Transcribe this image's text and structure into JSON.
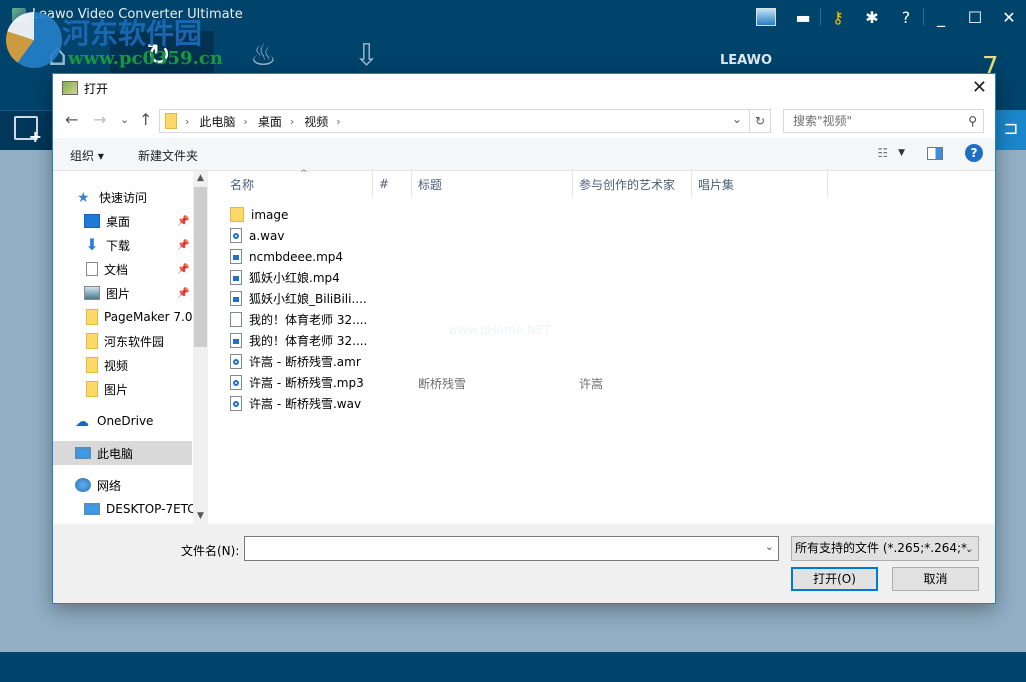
{
  "app": {
    "title": "Leawo Video Converter Ultimate",
    "brand": "LEAWO",
    "version_mark": "7",
    "watermark": {
      "line1": "河东软件园",
      "line2": "www.pc0359.cn"
    },
    "top_icons": [
      "store-icon",
      "chat-icon",
      "key-icon",
      "gear-icon",
      "help-icon",
      "minimize-icon",
      "maximize-icon",
      "close-icon"
    ],
    "accent": "#00436b"
  },
  "dialog": {
    "title": "打开",
    "close": "✕",
    "nav": {
      "back": "←",
      "forward": "→",
      "recent": "⌄",
      "up": "↑"
    },
    "breadcrumb": [
      "此电脑",
      "桌面",
      "视频"
    ],
    "search_placeholder": "搜索\"视频\"",
    "toolbar": {
      "organize": "组织 ▾",
      "new_folder": "新建文件夹"
    },
    "tree": {
      "items": [
        {
          "label": "快速访问",
          "icon": "star",
          "pinned": false
        },
        {
          "label": "桌面",
          "icon": "desktop",
          "pinned": true
        },
        {
          "label": "下载",
          "icon": "download",
          "pinned": true
        },
        {
          "label": "文档",
          "icon": "document",
          "pinned": true
        },
        {
          "label": "图片",
          "icon": "picture",
          "pinned": true
        },
        {
          "label": "PageMaker 7.0",
          "icon": "folder",
          "pinned": false
        },
        {
          "label": "河东软件园",
          "icon": "folder",
          "pinned": false
        },
        {
          "label": "视频",
          "icon": "folder",
          "pinned": false
        },
        {
          "label": "图片",
          "icon": "folder",
          "pinned": false
        },
        {
          "label": "OneDrive",
          "icon": "cloud",
          "pinned": false
        },
        {
          "label": "此电脑",
          "icon": "pc",
          "pinned": false,
          "selected": true
        },
        {
          "label": "网络",
          "icon": "network",
          "pinned": false
        },
        {
          "label": "DESKTOP-7ETC",
          "icon": "pc",
          "pinned": false
        }
      ]
    },
    "columns": [
      "名称",
      "#",
      "标题",
      "参与创作的艺术家",
      "唱片集"
    ],
    "files": [
      {
        "name": "image",
        "type": "folder",
        "title": "",
        "artist": ""
      },
      {
        "name": "a.wav",
        "type": "audio",
        "title": "",
        "artist": ""
      },
      {
        "name": "ncmbdeee.mp4",
        "type": "video",
        "title": "",
        "artist": ""
      },
      {
        "name": "狐妖小红娘.mp4",
        "type": "video",
        "title": "",
        "artist": ""
      },
      {
        "name": "狐妖小红娘_BiliBili....",
        "type": "video",
        "title": "",
        "artist": ""
      },
      {
        "name": "我的！体育老师 32....",
        "type": "blank",
        "title": "",
        "artist": ""
      },
      {
        "name": "我的！体育老师 32....",
        "type": "video",
        "title": "",
        "artist": ""
      },
      {
        "name": "许嵩 - 断桥残雪.amr",
        "type": "audio",
        "title": "",
        "artist": ""
      },
      {
        "name": "许嵩 - 断桥残雪.mp3",
        "type": "audio",
        "title": "断桥残雪",
        "artist": "许嵩"
      },
      {
        "name": "许嵩 - 断桥残雪.wav",
        "type": "audio",
        "title": "",
        "artist": ""
      }
    ],
    "watermark_text": "www.pHome.NET",
    "filename_label": "文件名(N):",
    "filename_value": "",
    "filter": "所有支持的文件 (*.265;*.264;*.",
    "open_button": "打开(O)",
    "cancel_button": "取消"
  }
}
